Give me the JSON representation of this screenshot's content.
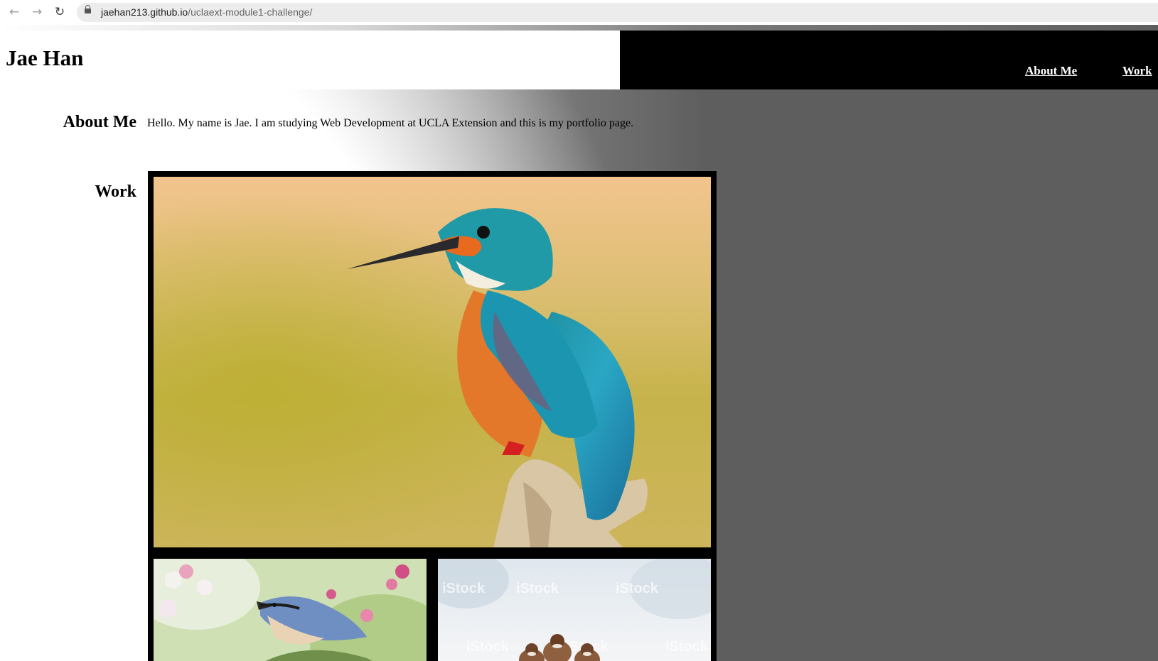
{
  "browser": {
    "back_icon": "arrow-left-icon",
    "forward_icon": "arrow-right-icon",
    "reload_icon": "reload-icon",
    "url_host": "jaehan213.github.io",
    "url_path": "/uclaext-module1-challenge/"
  },
  "header": {
    "title": "Jae Han",
    "nav": [
      {
        "label": "About Me"
      },
      {
        "label": "Work"
      }
    ]
  },
  "about": {
    "heading": "About Me",
    "text": "Hello. My name is Jae. I am studying Web Development at UCLA Extension and this is my portfolio page."
  },
  "work": {
    "heading": "Work",
    "tiles": [
      {
        "subject": "kingfisher-photo"
      },
      {
        "subject": "nuthatch-on-blossom-photo"
      },
      {
        "subject": "sparrows-in-snow-photo"
      }
    ],
    "watermark": "iStock"
  },
  "colors": {
    "header_nav_bg": "#000000",
    "page_gray": "#5e5e5e",
    "gallery_border": "#000000"
  }
}
